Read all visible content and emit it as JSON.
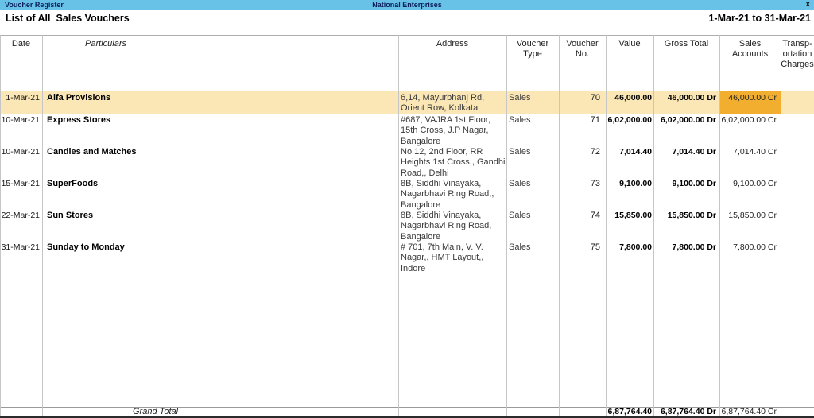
{
  "titlebar": {
    "title": "Voucher Register",
    "company": "National Enterprises",
    "close": "x"
  },
  "subheader": {
    "report_title_1": "List of All",
    "report_title_2": "Sales Vouchers",
    "period": "1-Mar-21 to 31-Mar-21"
  },
  "table": {
    "columns": [
      {
        "id": "date",
        "label": "Date"
      },
      {
        "id": "particulars",
        "label": "Particulars"
      },
      {
        "id": "address",
        "label": "Address"
      },
      {
        "id": "voucher_type",
        "label": "Voucher\nType"
      },
      {
        "id": "voucher_no",
        "label": "Voucher\nNo."
      },
      {
        "id": "value",
        "label": "Value"
      },
      {
        "id": "gross_total",
        "label": "Gross Total"
      },
      {
        "id": "sales_accounts",
        "label": "Sales\nAccounts"
      },
      {
        "id": "transportation_charges",
        "label": "Transp-\nortation\nCharges"
      }
    ],
    "rows": [
      {
        "date": "1-Mar-21",
        "particulars": "Alfa Provisions",
        "address": "6,14, Mayurbhanj Rd,\nOrient Row, Kolkata",
        "voucher_type": "Sales",
        "voucher_no": "70",
        "value": "46,000.00",
        "gross_total": "46,000.00 Dr",
        "sales_accounts": "46,000.00 Cr",
        "transportation_charges": ""
      },
      {
        "date": "10-Mar-21",
        "particulars": "Express Stores",
        "address": "#687, VAJRA 1st Floor,\n15th Cross, J.P Nagar,\nBangalore",
        "voucher_type": "Sales",
        "voucher_no": "71",
        "value": "6,02,000.00",
        "gross_total": "6,02,000.00 Dr",
        "sales_accounts": "6,02,000.00 Cr",
        "transportation_charges": ""
      },
      {
        "date": "10-Mar-21",
        "particulars": "Candles and Matches",
        "address": "No.12, 2nd Floor, RR\nHeights 1st Cross,, Gandhi\nRoad,, Delhi",
        "voucher_type": "Sales",
        "voucher_no": "72",
        "value": "7,014.40",
        "gross_total": "7,014.40 Dr",
        "sales_accounts": "7,014.40 Cr",
        "transportation_charges": ""
      },
      {
        "date": "15-Mar-21",
        "particulars": "SuperFoods",
        "address": "8B, Siddhi Vinayaka,\nNagarbhavi Ring Road,,\nBangalore",
        "voucher_type": "Sales",
        "voucher_no": "73",
        "value": "9,100.00",
        "gross_total": "9,100.00 Dr",
        "sales_accounts": "9,100.00 Cr",
        "transportation_charges": ""
      },
      {
        "date": "22-Mar-21",
        "particulars": "Sun Stores",
        "address": "8B, Siddhi Vinayaka,\nNagarbhavi Ring Road,\nBangalore",
        "voucher_type": "Sales",
        "voucher_no": "74",
        "value": "15,850.00",
        "gross_total": "15,850.00 Dr",
        "sales_accounts": "15,850.00 Cr",
        "transportation_charges": ""
      },
      {
        "date": "31-Mar-21",
        "particulars": "Sunday to Monday",
        "address": "# 701, 7th Main, V. V.\nNagar,, HMT Layout,,\nIndore",
        "voucher_type": "Sales",
        "voucher_no": "75",
        "value": "7,800.00",
        "gross_total": "7,800.00 Dr",
        "sales_accounts": "7,800.00 Cr",
        "transportation_charges": ""
      }
    ],
    "grand_total": {
      "label": "Grand Total",
      "value": "6,87,764.40",
      "gross_total": "6,87,764.40 Dr",
      "sales_accounts": "6,87,764.40 Cr"
    },
    "selected": {
      "row": 0,
      "column": "sales_accounts"
    }
  },
  "colors": {
    "titlebar_bg": "#68c2e8",
    "titlebar_text": "#0a1f5c",
    "row_highlight": "#fbe7b5",
    "selected_cell": "#f2ae2f",
    "grid_line": "#c6c6c6"
  }
}
